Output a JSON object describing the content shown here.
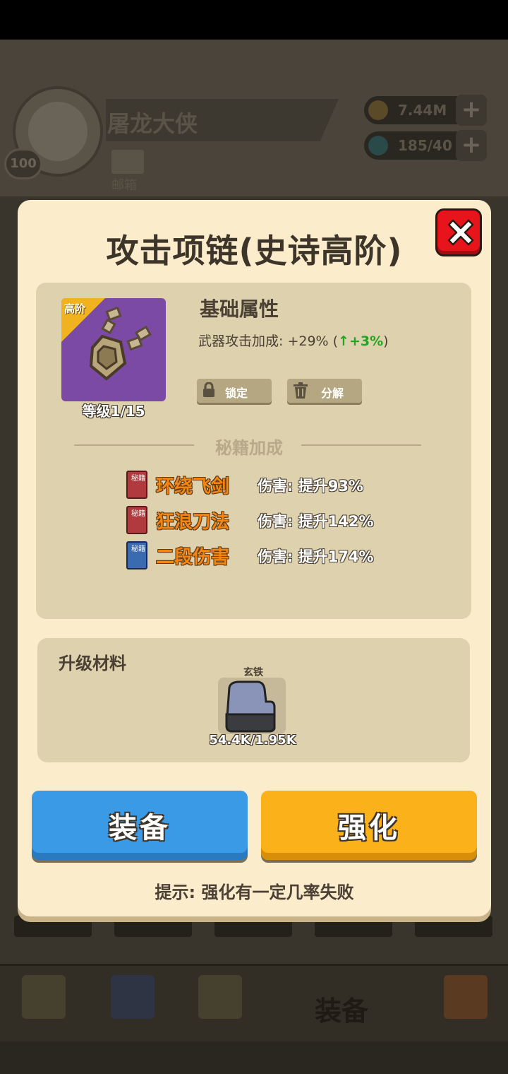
{
  "header": {
    "player_name": "屠龙大侠",
    "player_level": "100",
    "mail_label": "邮箱",
    "gold": "7.44M",
    "energy": "185/40"
  },
  "modal": {
    "title": "攻击项链(史诗高阶)",
    "item": {
      "tag": "高阶",
      "level": "等级1/15"
    },
    "base_attr": {
      "title": "基础属性",
      "stat_prefix": "武器攻击加成: +29% (",
      "stat_up": "↑+3%",
      "stat_suffix": ")"
    },
    "lock_label": "锁定",
    "decompose_label": "分解",
    "secret_title": "秘籍加成",
    "skills": [
      {
        "book": "秘籍",
        "name": "环绕飞剑",
        "effect": "伤害: 提升93%",
        "book_color": "#b03a3e"
      },
      {
        "book": "秘籍",
        "name": "狂浪刀法",
        "effect": "伤害: 提升142%",
        "book_color": "#b03a3e"
      },
      {
        "book": "秘籍",
        "name": "二段伤害",
        "effect": "伤害: 提升174%",
        "book_color": "#3a6ab0"
      }
    ],
    "materials": {
      "title": "升级材料",
      "item_name": "玄铁",
      "count": "54.4K/1.95K"
    },
    "equip_button": "装备",
    "upgrade_button": "强化",
    "hint": "提示: 强化有一定几率失败"
  },
  "tabbar": {
    "equip_label": "装备"
  },
  "colors": {
    "modal_bg": "#fbeccb",
    "panel_bg": "#ded1ad",
    "equip_blue": "#3a9ae6",
    "upgrade_orange": "#fbb11a",
    "close_red": "#e8141b",
    "skill_orange": "#f58512",
    "stat_green": "#1fa61f"
  }
}
